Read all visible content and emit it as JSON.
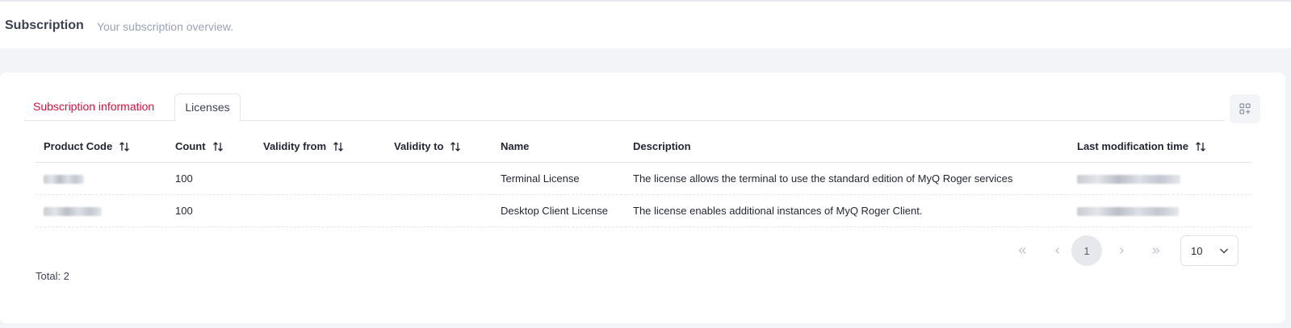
{
  "header": {
    "title": "Subscription",
    "subtitle": "Your subscription overview."
  },
  "tabs": [
    {
      "label": "Subscription information",
      "active": false
    },
    {
      "label": "Licenses",
      "active": true
    }
  ],
  "table": {
    "columns": [
      "Product Code",
      "Count",
      "Validity from",
      "Validity to",
      "Name",
      "Description",
      "Last modification time"
    ],
    "rows": [
      {
        "count": "100",
        "validity_from": "",
        "validity_to": "",
        "name": "Terminal License",
        "description": "The license allows the terminal to use the standard edition of MyQ Roger services"
      },
      {
        "count": "100",
        "validity_from": "",
        "validity_to": "",
        "name": "Desktop Client License",
        "description": "The license enables additional instances of MyQ Roger Client."
      }
    ]
  },
  "pagination": {
    "current_page": "1",
    "page_size": "10"
  },
  "footer": {
    "total": "Total: 2"
  },
  "colors": {
    "accent": "#d0143f"
  },
  "icons": {
    "sort": "sort-arrows-icon",
    "columns": "column-settings-icon",
    "first": "double-chevron-left-icon",
    "prev": "chevron-left-icon",
    "next": "chevron-right-icon",
    "last": "double-chevron-right-icon",
    "dropdown": "chevron-down-icon"
  }
}
